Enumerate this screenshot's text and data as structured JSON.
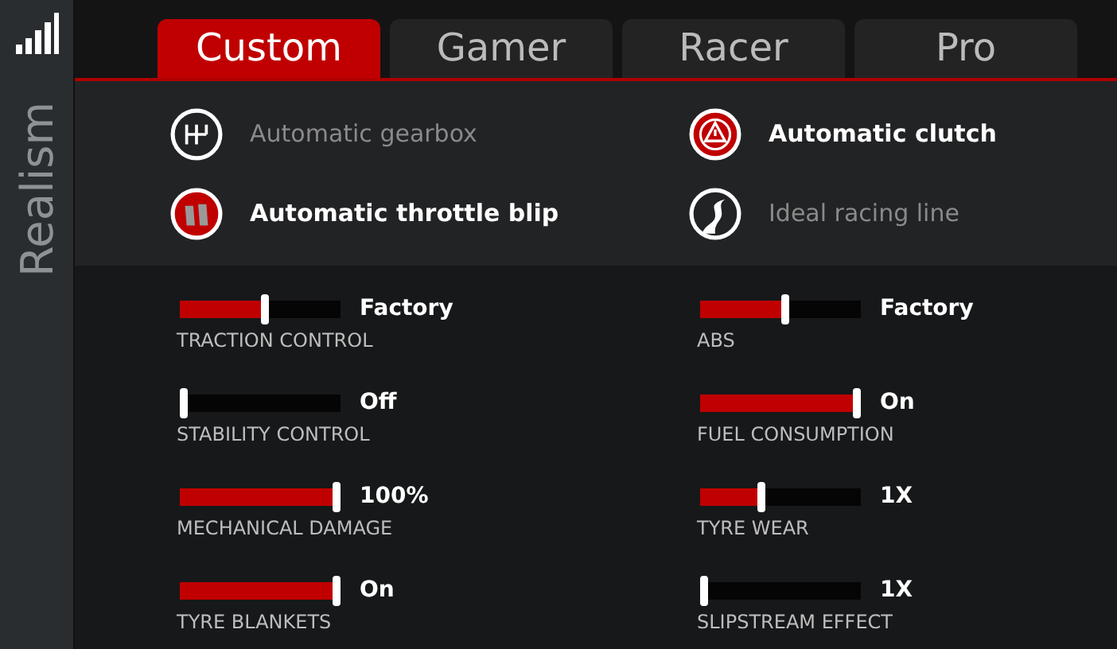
{
  "sidebar": {
    "title": "Realism"
  },
  "tabs": [
    {
      "label": "Custom",
      "selected": true
    },
    {
      "label": "Gamer",
      "selected": false
    },
    {
      "label": "Racer",
      "selected": false
    },
    {
      "label": "Pro",
      "selected": false
    }
  ],
  "assists": [
    {
      "kind": "gearbox",
      "label": "Automatic gearbox",
      "on": false
    },
    {
      "kind": "clutch",
      "label": "Automatic clutch",
      "on": true
    },
    {
      "kind": "throttle",
      "label": "Automatic throttle blip",
      "on": true
    },
    {
      "kind": "line",
      "label": "Ideal racing line",
      "on": false
    }
  ],
  "settings": [
    {
      "label": "TRACTION CONTROL",
      "reading": "Factory",
      "level": 0.53
    },
    {
      "label": "ABS",
      "reading": "Factory",
      "level": 0.53
    },
    {
      "label": "STABILITY CONTROL",
      "reading": "Off",
      "level": 0
    },
    {
      "label": "FUEL CONSUMPTION",
      "reading": "On",
      "level": 1
    },
    {
      "label": "MECHANICAL DAMAGE",
      "reading": "100%",
      "level": 1
    },
    {
      "label": "TYRE WEAR",
      "reading": "1X",
      "level": 0.37
    },
    {
      "label": "TYRE BLANKETS",
      "reading": "On",
      "level": 1
    },
    {
      "label": "SLIPSTREAM EFFECT",
      "reading": "1X",
      "level": 0
    }
  ]
}
